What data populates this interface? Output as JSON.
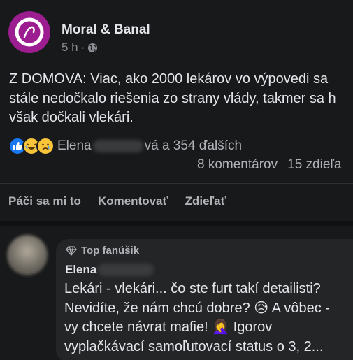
{
  "post": {
    "page_name": "Moral & Banal",
    "time": "5 h",
    "separator": "·",
    "audience_icon": "globe-icon",
    "body_lines": [
      "Z DOMOVA: Viac, ako 2000 lekárov vo výpovedi sa",
      "stále nedočkalo riešenia zo strany vlády, takmer sa h",
      "však dočkali vlekári."
    ]
  },
  "reactions": {
    "icons": [
      "like-icon",
      "laugh-emoji-icon",
      "sad-emoji-icon"
    ],
    "name_first": "Elena",
    "name_suffix": "vá a 354 ďalších",
    "comments_count": "8 komentárov",
    "shares_count": "15 zdieľa"
  },
  "actions": {
    "like": "Páči sa mi to",
    "comment": "Komentovať",
    "share": "Zdieľať"
  },
  "comment": {
    "badge": "Top fanúšik",
    "author": "Elena",
    "text_lines": [
      "Lekári - vlekári... čo ste furt takí detailisti?",
      "Nevidíte, že nám chcú dobre? 😥 A vôbec -",
      "vy chcete návrat mafie! 🤦‍♀️ Igorov",
      "vyplačkávací samoľutovací status o 3, 2..."
    ]
  },
  "colors": {
    "background": "#18191a",
    "bubble": "#242526",
    "avatar_brand": "#9b1d8f",
    "like_blue": "#1877f2"
  }
}
